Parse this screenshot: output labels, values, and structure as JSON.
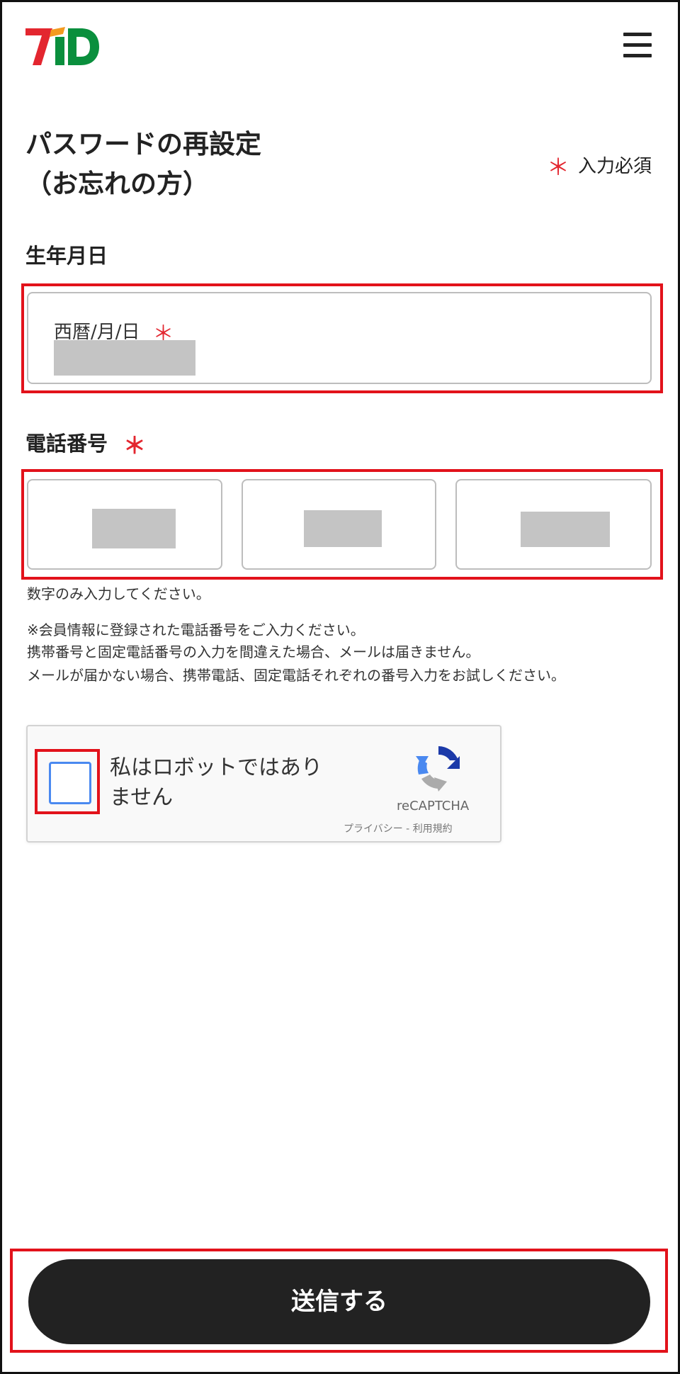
{
  "header": {
    "logo_text": "7iD",
    "menu_icon": "hamburger-menu-icon"
  },
  "title": {
    "line1": "パスワードの再設定",
    "line2": "（お忘れの方）"
  },
  "required_note": {
    "star": "＊",
    "label": "入力必須"
  },
  "birthday": {
    "section_label": "生年月日",
    "field_label": "西暦/月/日",
    "star": "＊"
  },
  "phone": {
    "section_label": "電話番号",
    "star": "＊",
    "hint": "数字のみ入力してください。",
    "notes": [
      "※会員情報に登録された電話番号をご入力ください。",
      "携帯番号と固定電話番号の入力を間違えた場合、メールは届きません。",
      "メールが届かない場合、携帯電話、固定電話それぞれの番号入力をお試しください。"
    ]
  },
  "captcha": {
    "label_line1": "私はロボットではあり",
    "label_line2": "ません",
    "brand": "reCAPTCHA",
    "privacy": "プライバシー",
    "separator": " - ",
    "terms": "利用規約"
  },
  "submit": {
    "label": "送信する"
  },
  "colors": {
    "accent_red": "#e2121b",
    "button_dark": "#222222",
    "logo_red": "#e3262f",
    "logo_green": "#0a8f3d",
    "checkbox_blue": "#4a89f0"
  }
}
